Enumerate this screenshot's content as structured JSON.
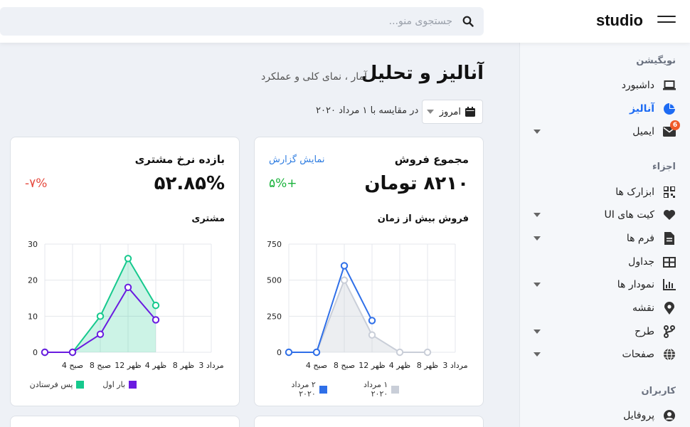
{
  "brand": "studio",
  "search": {
    "placeholder": "جستجوی منو..."
  },
  "header": {
    "title": "آنالیز و تحلیل",
    "subtitle": "آمار ، نمای کلی و عملکرد",
    "date_select": "امروز",
    "compare_text": "در مقایسه با ۱ مرداد ۲۰۲۰"
  },
  "sidebar": {
    "sections": [
      {
        "title": "نویگیشن"
      },
      {
        "title": "اجزاء"
      },
      {
        "title": "کاربران"
      }
    ],
    "items": [
      {
        "label": "داشبورد",
        "icon": "laptop-icon"
      },
      {
        "label": "آنالیز",
        "icon": "pie-chart-icon",
        "active": true
      },
      {
        "label": "ایمیل",
        "icon": "mail-icon",
        "badge": "6"
      },
      {
        "label": "ابزارک ها",
        "icon": "qr-grid-icon"
      },
      {
        "label": "کیت های UI",
        "icon": "heart-icon"
      },
      {
        "label": "فرم ها",
        "icon": "file-icon"
      },
      {
        "label": "جداول",
        "icon": "table-icon"
      },
      {
        "label": "نمودار ها",
        "icon": "bar-chart-icon"
      },
      {
        "label": "نقشه",
        "icon": "map-pin-icon"
      },
      {
        "label": "طرح",
        "icon": "layout-icon"
      },
      {
        "label": "صفحات",
        "icon": "globe-icon"
      },
      {
        "label": "پروفایل",
        "icon": "user-icon"
      }
    ]
  },
  "cards": {
    "sales": {
      "title": "مجموع فروش",
      "link": "نمایش گزارش",
      "value": "۸۲۱۰ تومان",
      "change": "+۵%",
      "chart_title": "فروش بیش از زمان",
      "legend": [
        "۱ مرداد ۲۰۲۰",
        "۲ مرداد ۲۰۲۰"
      ]
    },
    "customer": {
      "title": "بازده نرخ مشتری",
      "value": "۵۲.۸۵%",
      "change": "۷%-",
      "chart_title": "مشتری",
      "legend": [
        "بار اول",
        "پس فرستادن"
      ]
    }
  },
  "colors": {
    "accent": "#1d6bf3",
    "sales_current": "#2f6fe8",
    "sales_previous": "#c9ced8",
    "customer_first": "#6a1be0",
    "customer_return": "#16c98d",
    "positive": "#19b23b",
    "negative": "#e5483d"
  },
  "chart_data": [
    {
      "type": "area",
      "categories": [
        "4 صبح",
        "8 صبح",
        "12 ظهر",
        "4 ظهر",
        "8 ظهر",
        "3 مرداد"
      ],
      "ylim": [
        0,
        750
      ],
      "yticks": [
        0,
        250,
        500,
        750
      ],
      "series": [
        {
          "name": "۱ مرداد ۲۰۲۰",
          "values": [
            0,
            0,
            500,
            120,
            0,
            0
          ]
        },
        {
          "name": "۲ مرداد ۲۰۲۰",
          "values": [
            0,
            0,
            600,
            220
          ]
        }
      ]
    },
    {
      "type": "area",
      "categories": [
        "4 صبح",
        "8 صبح",
        "12 ظهر",
        "4 ظهر",
        "8 ظهر",
        "3 مرداد"
      ],
      "ylim": [
        0,
        30
      ],
      "yticks": [
        0,
        10,
        20,
        30
      ],
      "series": [
        {
          "name": "پس فرستادن",
          "values": [
            0,
            0,
            10,
            26,
            13
          ]
        },
        {
          "name": "بار اول",
          "values": [
            0,
            0,
            5,
            18,
            9
          ]
        }
      ]
    }
  ]
}
